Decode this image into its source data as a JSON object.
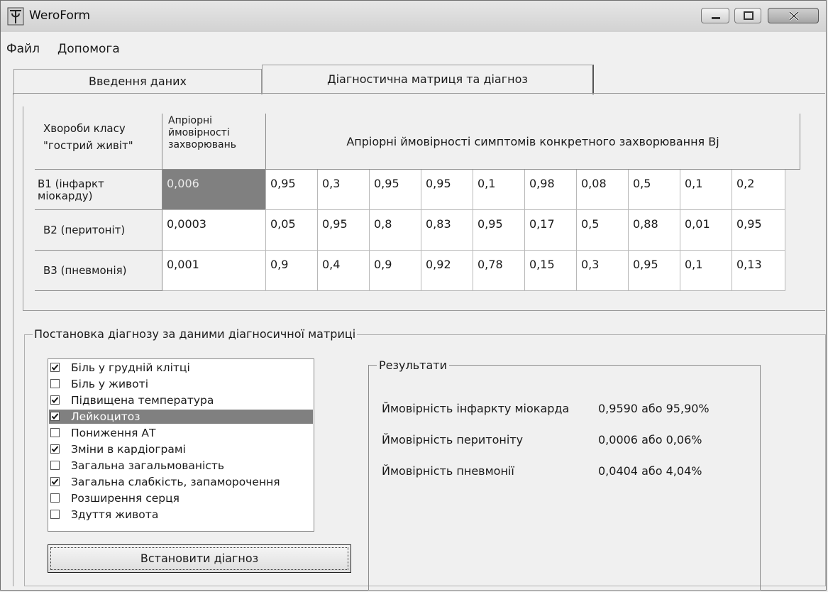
{
  "window": {
    "title": "WeroForm"
  },
  "menu": [
    {
      "label": "Файл"
    },
    {
      "label": "Допомога"
    }
  ],
  "tabs": [
    {
      "label": "Введення даних",
      "active": false
    },
    {
      "label": "Діагностична матриця та діагноз",
      "active": true
    }
  ],
  "matrix": {
    "col_disease": "Хвороби класу \"гострий живіт\"",
    "col_prior": "Апріорні ймовірності захворювань",
    "col_symptoms": "Апріорні ймовірності симптомів конкретного захворювання Bj",
    "rows": [
      {
        "disease": "B1 (інфаркт міокарду)",
        "prior": "0,006",
        "values": [
          "0,95",
          "0,3",
          "0,95",
          "0,95",
          "0,1",
          "0,98",
          "0,08",
          "0,5",
          "0,1",
          "0,2"
        ]
      },
      {
        "disease": "B2 (перитоніт)",
        "prior": "0,0003",
        "values": [
          "0,05",
          "0,95",
          "0,8",
          "0,83",
          "0,95",
          "0,17",
          "0,5",
          "0,88",
          "0,01",
          "0,95"
        ]
      },
      {
        "disease": "B3 (пневмонія)",
        "prior": "0,001",
        "values": [
          "0,9",
          "0,4",
          "0,9",
          "0,92",
          "0,78",
          "0,15",
          "0,3",
          "0,95",
          "0,1",
          "0,13"
        ]
      }
    ]
  },
  "diagnosis": {
    "group_title": "Постановка діагнозу за даними діагносичної матриці",
    "symptoms": [
      {
        "label": "Біль у грудній клітці",
        "checked": true,
        "selected": false
      },
      {
        "label": "Біль у животі",
        "checked": false,
        "selected": false
      },
      {
        "label": "Підвищена температура",
        "checked": true,
        "selected": false
      },
      {
        "label": "Лейкоцитоз",
        "checked": true,
        "selected": true
      },
      {
        "label": "Пониження АТ",
        "checked": false,
        "selected": false
      },
      {
        "label": "Зміни в кардіограмі",
        "checked": true,
        "selected": false
      },
      {
        "label": "Загальна загальмованість",
        "checked": false,
        "selected": false
      },
      {
        "label": "Загальна слабкість, запаморочення",
        "checked": true,
        "selected": false
      },
      {
        "label": "Розширення серця",
        "checked": false,
        "selected": false
      },
      {
        "label": "Здуття живота",
        "checked": false,
        "selected": false
      }
    ],
    "button_label": "Встановити діагноз",
    "results": {
      "title": "Результати",
      "items": [
        {
          "label": "Ймовірність інфаркту міокарда",
          "value": "0,9590 або 95,90%"
        },
        {
          "label": "Ймовірність перитоніту",
          "value": "0,0006 або 0,06%"
        },
        {
          "label": "Ймовірність пневмонії",
          "value": "0,0404 або 4,04%"
        }
      ]
    }
  },
  "colors": {
    "selection": "#808080",
    "window_bg": "#f0f0f0"
  }
}
